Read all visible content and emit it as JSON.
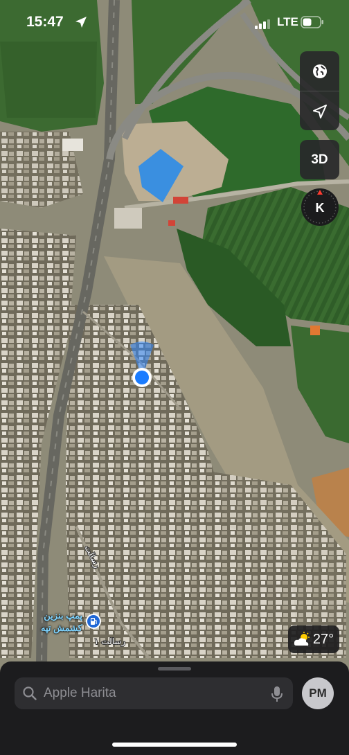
{
  "status": {
    "time": "15:47",
    "carrier": "LTE"
  },
  "map": {
    "controls": {
      "three_d_label": "3D",
      "compass_label": "K"
    },
    "poi": {
      "line1": "پمپ بنزین",
      "line2": "کشمش تپه"
    },
    "road_labels": [
      "رسالت",
      "رسالت ۱"
    ],
    "weather": {
      "temperature": "27°",
      "icon": "partly-cloudy-icon"
    }
  },
  "sheet": {
    "search_placeholder": "Apple Harita",
    "avatar_initials": "PM"
  },
  "colors": {
    "user_location": "#1a7cff",
    "poi_text": "#7fd4ff",
    "sheet_bg": "#1c1c1e"
  }
}
